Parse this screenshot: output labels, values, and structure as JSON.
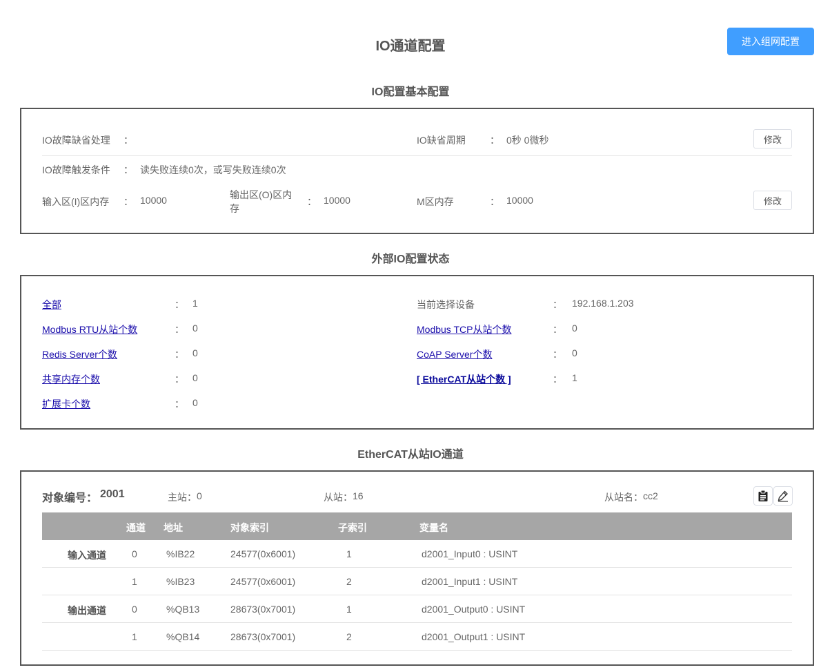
{
  "header": {
    "title": "IO通道配置",
    "network_button": "进入组网配置"
  },
  "basic": {
    "section_title": "IO配置基本配置",
    "fault_default_label": "IO故障缺省处理",
    "fault_default_value": "",
    "default_period_label": "IO缺省周期",
    "default_period_value": "0秒 0微秒",
    "fault_trigger_label": "IO故障触发条件",
    "fault_trigger_value": "读失败连续0次，或写失败连续0次",
    "input_mem_label": "输入区(I)区内存",
    "input_mem_value": "10000",
    "output_mem_label_1": "输出区(O)区内",
    "output_mem_label_2": "存",
    "output_mem_value": "10000",
    "m_mem_label": "M区内存",
    "m_mem_value": "10000",
    "colon": "：",
    "modify_label": "修改"
  },
  "external": {
    "section_title": "外部IO配置状态",
    "colon": "：",
    "left_items": [
      {
        "label": "全部",
        "value": "1"
      },
      {
        "label": "Modbus RTU从站个数",
        "value": "0"
      },
      {
        "label": "Redis Server个数",
        "value": "0"
      },
      {
        "label": "共享内存个数",
        "value": "0"
      },
      {
        "label": "扩展卡个数",
        "value": "0"
      }
    ],
    "current_device_label": "当前选择设备",
    "current_device_value": "192.168.1.203",
    "right_items": [
      {
        "label": "Modbus TCP从站个数",
        "value": "0"
      },
      {
        "label": "CoAP Server个数",
        "value": "0"
      },
      {
        "label": "[ EtherCAT从站个数 ]",
        "value": "1"
      }
    ]
  },
  "ethercat": {
    "section_title": "EtherCAT从站IO通道",
    "object_no_label": "对象编号：",
    "object_no_value": "2001",
    "master_label": "主站：",
    "master_value": "0",
    "slave_label": "从站：",
    "slave_value": "16",
    "slave_name_label": "从站名：",
    "slave_name_value": "cc2",
    "columns": [
      "通道",
      "地址",
      "对象索引",
      "子索引",
      "变量名"
    ],
    "rows": [
      {
        "group": "输入通道",
        "channel": "0",
        "address": "%IB22",
        "object_index": "24577(0x6001)",
        "sub_index": "1",
        "var_name": "d2001_Input0 : USINT"
      },
      {
        "group": "",
        "channel": "1",
        "address": "%IB23",
        "object_index": "24577(0x6001)",
        "sub_index": "2",
        "var_name": "d2001_Input1 : USINT"
      },
      {
        "group": "输出通道",
        "channel": "0",
        "address": "%QB13",
        "object_index": "28673(0x7001)",
        "sub_index": "1",
        "var_name": "d2001_Output0 : USINT"
      },
      {
        "group": "",
        "channel": "1",
        "address": "%QB14",
        "object_index": "28673(0x7001)",
        "sub_index": "2",
        "var_name": "d2001_Output1 : USINT"
      }
    ]
  }
}
